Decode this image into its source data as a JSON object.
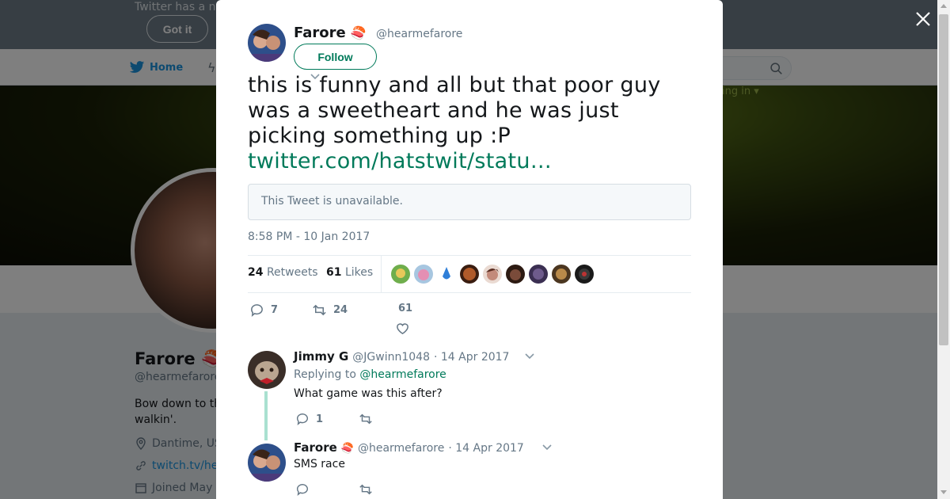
{
  "background": {
    "notice_text": "Twitter has a n",
    "got_it_label": "Got it",
    "nav_home_label": "Home",
    "login_hint": "ing in ▾",
    "profile_name": "Farore 🍣",
    "profile_handle": "@hearmefarore",
    "profile_bio": "Bow down to th walkin'.",
    "location": "Dantime, US",
    "website": "twitch.tv/he",
    "joined": "Joined May"
  },
  "modal": {
    "author": {
      "name": "Farore",
      "emoji": "🍣",
      "handle": "@hearmefarore",
      "follow_label": "Follow"
    },
    "tweet_text": "this is funny and all but that poor guy was a sweetheart and he was just picking something up :P ",
    "tweet_link": "twitter.com/hatstwit/statu…",
    "unavailable_text": "This Tweet is unavailable.",
    "timestamp": "8:58 PM - 10 Jan 2017",
    "stats": {
      "retweets_count": "24",
      "retweets_label": "Retweets",
      "likes_count": "61",
      "likes_label": "Likes"
    },
    "actions": {
      "reply_count": "7",
      "retweet_count": "24",
      "like_count": "61"
    },
    "likers": [
      "#6fae4c",
      "#e48fb3",
      "#2f7fd8",
      "#b05a2a",
      "#c38a7a",
      "#7a4b3a",
      "#6e5b8c",
      "#b98a4a",
      "#3a3a3a"
    ]
  },
  "replies": [
    {
      "name": "Jimmy G",
      "emoji": "",
      "handle": "@JGwinn1048",
      "date": "· 14 Apr 2017",
      "replying_prefix": "Replying to",
      "replying_to": "@hearmefarore",
      "text": "What game was this after?",
      "reply_count": "1",
      "retweet_count": ""
    },
    {
      "name": "Farore",
      "emoji": "🍣",
      "handle": "@hearmefarore",
      "date": "· 14 Apr 2017",
      "text": "SMS race",
      "reply_count": "",
      "retweet_count": ""
    }
  ],
  "colors": {
    "accent": "#007a5a",
    "twitter_blue": "#1b95e0",
    "muted": "#657786",
    "thread_line": "#a9e1d0"
  }
}
